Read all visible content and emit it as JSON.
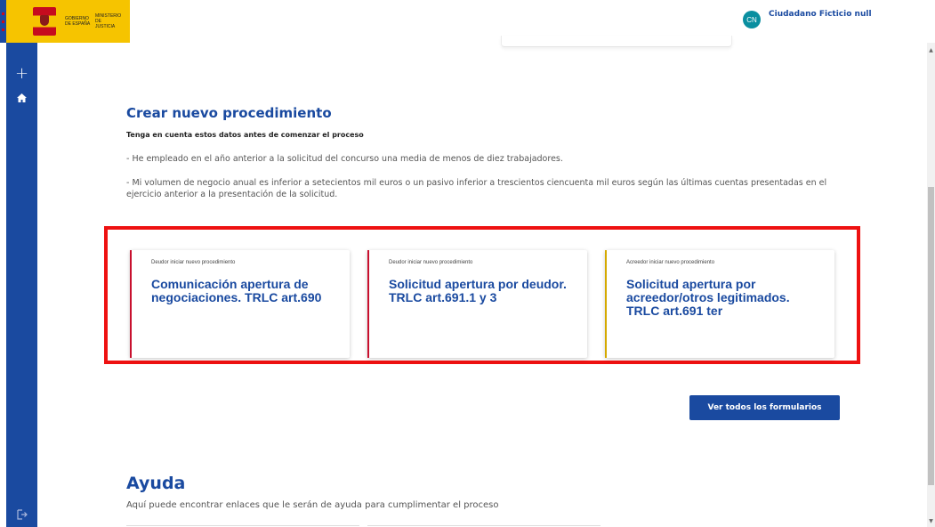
{
  "header": {
    "logo_text_left": "GOBIERNO DE ESPAÑA",
    "logo_text_right": "MINISTERIO DE JUSTICIA",
    "user_initials": "CN",
    "user_name": "Ciudadano Ficticio null"
  },
  "sidebar": {
    "add_glyph": "+",
    "icons": [
      "add-icon",
      "home-icon",
      "logout-icon"
    ]
  },
  "main": {
    "title": "Crear nuevo procedimiento",
    "subtitle": "Tenga en cuenta estos datos antes de comenzar el proceso",
    "requirements": [
      "- He empleado en el año anterior a la solicitud del concurso una media de menos de diez trabajadores.",
      "- Mi volumen de negocio  anual es inferior a setecientos mil  euros o un pasivo inferior a trescientos ciencuenta mil  euros según las últimas cuentas presentadas en el ejercicio anterior a la presentación de la solicitud."
    ],
    "cards": [
      {
        "category": "Deudor iniciar nuevo procedimiento",
        "title": "Comunicación apertura de negociaciones. TRLC art.690",
        "accent": "#c8102e"
      },
      {
        "category": "Deudor iniciar nuevo procedimiento",
        "title": "Solicitud apertura por deudor. TRLC art.691.1 y 3",
        "accent": "#c8102e"
      },
      {
        "category": "Acreedor iniciar nuevo procedimiento",
        "title": "Solicitud apertura por acreedor/otros legitimados. TRLC art.691 ter",
        "accent": "#d4a900"
      }
    ],
    "view_all_button": "Ver todos los formularios"
  },
  "help": {
    "title": "Ayuda",
    "subtitle": "Aquí puede encontrar enlaces que le serán de ayuda para cumplimentar el proceso"
  },
  "colors": {
    "brand_blue": "#1a4aa0",
    "highlight_red": "#ee1111",
    "logo_yellow": "#f6c400",
    "avatar_teal": "#0a8fa0"
  }
}
